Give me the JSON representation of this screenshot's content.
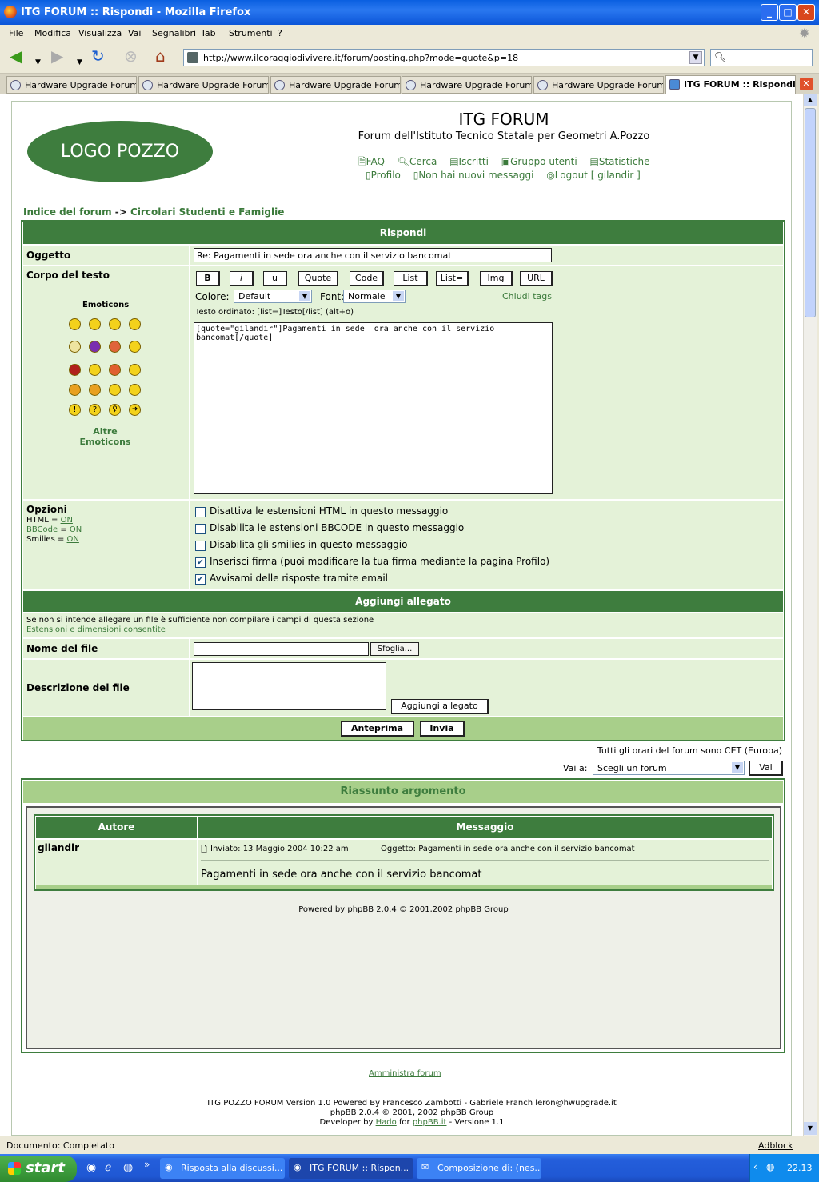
{
  "window": {
    "title": "ITG FORUM :: Rispondi - Mozilla Firefox"
  },
  "menu": [
    "File",
    "Modifica",
    "Visualizza",
    "Vai",
    "Segnalibri",
    "Tab",
    "Strumenti",
    "?"
  ],
  "url": "http://www.ilcoraggiodivivere.it/forum/posting.php?mode=quote&p=18",
  "tabs": [
    "Hardware Upgrade Forum...",
    "Hardware Upgrade Forum...",
    "Hardware Upgrade Forum...",
    "Hardware Upgrade Forum...",
    "Hardware Upgrade Forum...",
    "ITG FORUM :: Rispondi"
  ],
  "header": {
    "logo": "LOGO POZZO",
    "title": "ITG FORUM",
    "subtitle": "Forum dell'Istituto Tecnico Statale per Geometri A.Pozzo",
    "links": [
      "FAQ",
      "Cerca",
      "Iscritti",
      "Gruppo utenti",
      "Statistiche"
    ],
    "links2": [
      "Profilo",
      "Non hai nuovi messaggi",
      "Logout [ gilandir ]"
    ]
  },
  "breadcrumb": {
    "index": "Indice del forum",
    "sep": "->",
    "forum": "Circolari Studenti e Famiglie"
  },
  "reply": {
    "title": "Rispondi",
    "subject_label": "Oggetto",
    "subject_value": "Re: Pagamenti in sede  ora anche con il servizio bancomat",
    "body_label": "Corpo del testo",
    "emoticons_label": "Emoticons",
    "more_emoticons": "Altre Emoticons",
    "bbcode_buttons": [
      "B",
      "i",
      "u",
      "Quote",
      "Code",
      "List",
      "List=",
      "Img",
      "URL"
    ],
    "color_label": "Colore:",
    "color_value": "Default",
    "font_label": "Font:",
    "font_value": "Normale",
    "close_tags": "Chiudi tags",
    "hint": "Testo ordinato: [list=]Testo[/list]  (alt+o)",
    "body_value": "[quote=\"gilandir\"]Pagamenti in sede  ora anche con il servizio bancomat[/quote]",
    "options_label": "Opzioni",
    "html_status": "HTML = ",
    "bbcode_status": "BBCode",
    "smilies_status": "Smilies = ",
    "on": "ON",
    "eq": " = ",
    "options": [
      {
        "label": "Disattiva le estensioni HTML in questo messaggio",
        "checked": false
      },
      {
        "label": "Disabilita le estensioni BBCODE in questo messaggio",
        "checked": false
      },
      {
        "label": "Disabilita gli smilies in questo messaggio",
        "checked": false
      },
      {
        "label": "Inserisci firma (puoi modificare la tua firma mediante la pagina Profilo)",
        "checked": true
      },
      {
        "label": "Avvisami delle risposte tramite email",
        "checked": true
      }
    ]
  },
  "attach": {
    "title": "Aggiungi allegato",
    "note": "Se non si intende allegare un file è sufficiente non compilare i campi di questa sezione",
    "ext_link": "Estensioni e dimensioni consentite",
    "file_label": "Nome del file",
    "browse": "Sfoglia...",
    "desc_label": "Descrizione del file",
    "add_button": "Aggiungi allegato"
  },
  "actions": {
    "preview": "Anteprima",
    "send": "Invia"
  },
  "timezone": "Tutti gli orari del forum sono CET (Europa)",
  "jump": {
    "label": "Vai a:",
    "value": "Scegli un forum",
    "button": "Vai"
  },
  "summary": {
    "title": "Riassunto argomento",
    "col_author": "Autore",
    "col_message": "Messaggio",
    "author": "gilandir",
    "posted": "Inviato: 13 Maggio 2004 10:22 am",
    "subject": "Oggetto: Pagamenti in sede ora anche con il servizio bancomat",
    "text": "Pagamenti in sede ora anche con il servizio bancomat",
    "powered": "Powered by phpBB 2.0.4 © 2001,2002 phpBB Group"
  },
  "footer": {
    "admin": "Amministra forum",
    "line1": "ITG POZZO FORUM Version 1.0 Powered By Francesco Zambotti - Gabriele Franch leron@hwupgrade.it",
    "line2": "phpBB 2.0.4 © 2001, 2002 phpBB Group",
    "line3_a": "Developer by ",
    "hado": "Hado",
    "for": " for ",
    "phpbbit": "phpBB.it",
    "line3_b": " - Versione 1.1"
  },
  "status": {
    "text": "Documento: Completato",
    "adblock": "Adblock"
  },
  "taskbar": {
    "start": "start",
    "tasks": [
      "Risposta alla discussi...",
      "ITG FORUM :: Rispon...",
      "Composizione di: (nes..."
    ],
    "clock": "22.13"
  }
}
